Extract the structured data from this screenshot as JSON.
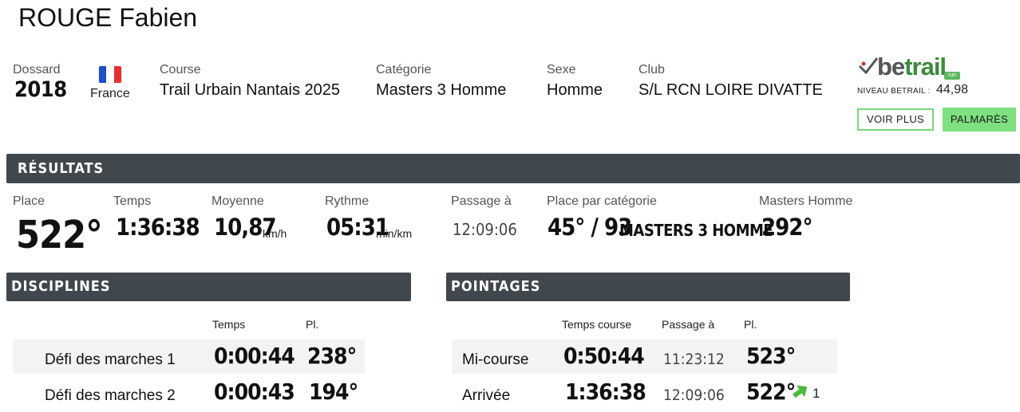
{
  "athlete": {
    "name": "ROUGE Fabien",
    "dossard_label": "Dossard",
    "dossard": "2018",
    "country": "France",
    "course_label": "Course",
    "course": "Trail Urbain Nantais 2025",
    "category_label": "Catégorie",
    "category": "Masters 3 Homme",
    "sex_label": "Sexe",
    "sex": "Homme",
    "club_label": "Club",
    "club": "S/L RCN LOIRE DIVATTE"
  },
  "betrail": {
    "logo_be": "be",
    "logo_trail": "trail",
    "logo_run": "run",
    "niveau_label": "NIVEAU BETRAIL :",
    "niveau_value": "44,98",
    "voir_plus": "VOIR PLUS",
    "palmares": "PALMARÈS"
  },
  "results": {
    "title": "RÉSULTATS",
    "place_label": "Place",
    "place": "522°",
    "temps_label": "Temps",
    "temps": "1:36:38",
    "moyenne_label": "Moyenne",
    "moyenne": "10,87",
    "moyenne_unit": "km/h",
    "rythme_label": "Rythme",
    "rythme": "05:31",
    "rythme_unit": "min/km",
    "passage_label": "Passage à",
    "passage": "12:09:06",
    "cat_place_label": "Place par catégorie",
    "cat_place": "45° / 93",
    "cat_name": "MASTERS 3 HOMME",
    "masters_label": "Masters Homme",
    "masters_place": "292°"
  },
  "disciplines": {
    "title": "DISCIPLINES",
    "col_temps": "Temps",
    "col_pl": "Pl.",
    "rows": [
      {
        "name": "Défi des marches 1",
        "time": "0:00:44",
        "place": "238°"
      },
      {
        "name": "Défi des marches 2",
        "time": "0:00:43",
        "place": "194°"
      }
    ]
  },
  "pointages": {
    "title": "POINTAGES",
    "col_temps": "Temps course",
    "col_passage": "Passage à",
    "col_pl": "Pl.",
    "rows": [
      {
        "name": "Mi-course",
        "time": "0:50:44",
        "passage": "11:23:12",
        "place": "523°"
      },
      {
        "name": "Arrivée",
        "time": "1:36:38",
        "passage": "12:09:06",
        "place": "522°",
        "gain": "1"
      }
    ]
  },
  "colors": {
    "bar": "#40474d",
    "accent_green": "#7ee07e",
    "flag_blue": "#1f4fc4",
    "flag_white": "#ffffff",
    "flag_red": "#e63030"
  }
}
